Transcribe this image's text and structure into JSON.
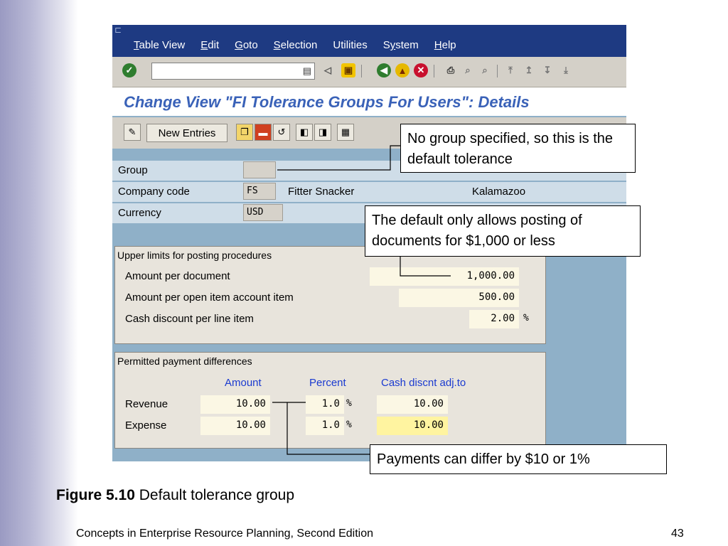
{
  "menu": {
    "items": [
      {
        "accel": "T",
        "rest": "able View"
      },
      {
        "accel": "E",
        "rest": "dit"
      },
      {
        "accel": "G",
        "rest": "oto"
      },
      {
        "accel": "S",
        "rest": "election"
      },
      {
        "accel": "",
        "rest": "Utilities"
      },
      {
        "accel": "S",
        "rest": "y",
        "label": "System"
      },
      {
        "accel": "H",
        "rest": "elp"
      }
    ]
  },
  "screen": {
    "title": "Change View \"FI Tolerance Groups For Users\": Details",
    "new_entries_label": "New Entries"
  },
  "header": {
    "group_label": "Group",
    "group_value": "",
    "company_code_label": "Company code",
    "company_code_value": "FS",
    "company_name": "Fitter Snacker",
    "city": "Kalamazoo",
    "currency_label": "Currency",
    "currency_value": "USD"
  },
  "upper_limits": {
    "title": "Upper limits for posting procedures",
    "rows": [
      {
        "label": "Amount per document",
        "value": "1,000.00"
      },
      {
        "label": "Amount per open item account item",
        "value": "500.00"
      },
      {
        "label": "Cash discount per line item",
        "value": "2.00",
        "unit": "%"
      }
    ]
  },
  "payment_diff": {
    "title": "Permitted payment differences",
    "col_amount": "Amount",
    "col_percent": "Percent",
    "col_cash": "Cash discnt adj.to",
    "rows": [
      {
        "label": "Revenue",
        "amount": "10.00",
        "percent": "1.0",
        "pct_sign": "%",
        "cash": "10.00"
      },
      {
        "label": "Expense",
        "amount": "10.00",
        "percent": "1.0",
        "pct_sign": "%",
        "cash": "10.00"
      }
    ]
  },
  "callouts": {
    "no_group": "No group specified, so this is the default tolerance",
    "default_only": "The default only allows posting of documents for $1,000 or less",
    "payments": "Payments can differ by $10 or 1%"
  },
  "caption": {
    "figure": "Figure 5.10",
    "text": "Default tolerance group"
  },
  "footer": {
    "book": "Concepts in Enterprise Resource Planning, Second Edition",
    "page": "43"
  },
  "colors": {
    "menubar": "#1e3a82",
    "title": "#3a62b8",
    "background": "#8fb0c8",
    "column_header": "#1a3ad0"
  }
}
